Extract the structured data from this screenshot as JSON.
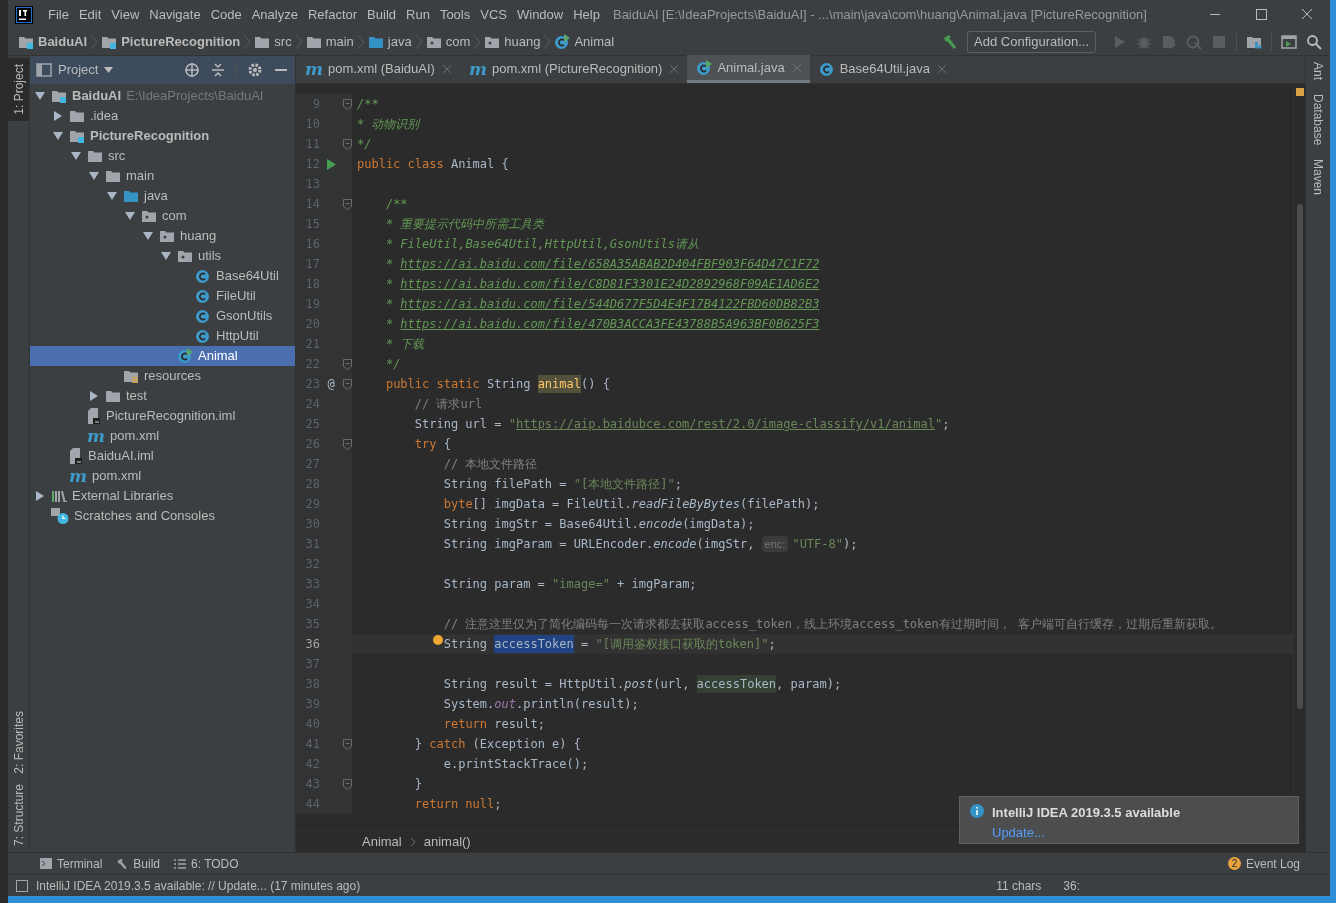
{
  "window": {
    "title": "BaiduAI [E:\\IdeaProjects\\BaiduAI] - ...\\main\\java\\com\\huang\\Animal.java [PictureRecognition]"
  },
  "menu": [
    "File",
    "Edit",
    "View",
    "Navigate",
    "Code",
    "Analyze",
    "Refactor",
    "Build",
    "Run",
    "Tools",
    "VCS",
    "Window",
    "Help"
  ],
  "breadcrumbs": [
    {
      "label": "BaiduAI",
      "kind": "module"
    },
    {
      "label": "PictureRecognition",
      "kind": "module"
    },
    {
      "label": "src",
      "kind": "folder"
    },
    {
      "label": "main",
      "kind": "folder"
    },
    {
      "label": "java",
      "kind": "source"
    },
    {
      "label": "com",
      "kind": "package"
    },
    {
      "label": "huang",
      "kind": "package"
    },
    {
      "label": "Animal",
      "kind": "runclass"
    }
  ],
  "toolbar": {
    "config_button": "Add Configuration..."
  },
  "left_strip": [
    "1: Project",
    "2: Favorites",
    "7: Structure"
  ],
  "right_strip": [
    "Ant",
    "Database",
    "Maven"
  ],
  "project": {
    "title": "Project",
    "tree": [
      {
        "label": "BaiduAI",
        "kind": "module",
        "hint": "E:\\IdeaProjects\\BaiduAI",
        "expanded": true,
        "selected": false,
        "children": [
          {
            "label": ".idea",
            "kind": "folder",
            "expanded": false,
            "selected": false
          },
          {
            "label": "PictureRecognition",
            "kind": "module",
            "expanded": true,
            "selected": false,
            "children": [
              {
                "label": "src",
                "kind": "folder",
                "expanded": true,
                "selected": false,
                "children": [
                  {
                    "label": "main",
                    "kind": "folder",
                    "expanded": true,
                    "selected": false,
                    "children": [
                      {
                        "label": "java",
                        "kind": "source",
                        "expanded": true,
                        "selected": false,
                        "children": [
                          {
                            "label": "com",
                            "kind": "package",
                            "expanded": true,
                            "selected": false,
                            "children": [
                              {
                                "label": "huang",
                                "kind": "package",
                                "expanded": true,
                                "selected": false,
                                "children": [
                                  {
                                    "label": "utils",
                                    "kind": "package",
                                    "expanded": true,
                                    "selected": false,
                                    "children": [
                                      {
                                        "label": "Base64Util",
                                        "kind": "class",
                                        "selected": false
                                      },
                                      {
                                        "label": "FileUtil",
                                        "kind": "class",
                                        "selected": false
                                      },
                                      {
                                        "label": "GsonUtils",
                                        "kind": "class",
                                        "selected": false
                                      },
                                      {
                                        "label": "HttpUtil",
                                        "kind": "class",
                                        "selected": false
                                      }
                                    ]
                                  },
                                  {
                                    "label": "Animal",
                                    "kind": "runclass",
                                    "selected": true
                                  }
                                ]
                              }
                            ]
                          }
                        ]
                      },
                      {
                        "label": "resources",
                        "kind": "resources",
                        "selected": false
                      }
                    ]
                  },
                  {
                    "label": "test",
                    "kind": "folder",
                    "expanded": false,
                    "selected": false
                  }
                ]
              },
              {
                "label": "PictureRecognition.iml",
                "kind": "iml",
                "selected": false
              },
              {
                "label": "pom.xml",
                "kind": "maven",
                "glyph": "m",
                "selected": false
              }
            ]
          },
          {
            "label": "BaiduAI.iml",
            "kind": "iml",
            "selected": false
          },
          {
            "label": "pom.xml",
            "kind": "maven",
            "glyph": "m",
            "selected": false
          }
        ]
      },
      {
        "label": "External Libraries",
        "kind": "libraries",
        "expanded": false,
        "selected": false
      },
      {
        "label": "Scratches and Consoles",
        "kind": "scratches",
        "selected": false
      }
    ]
  },
  "tabs": [
    {
      "label": "pom.xml (BaiduAI)",
      "kind": "maven",
      "glyph": "m",
      "selected": false
    },
    {
      "label": "pom.xml (PictureRecognition)",
      "kind": "maven",
      "glyph": "m",
      "selected": false
    },
    {
      "label": "Animal.java",
      "kind": "runclass",
      "selected": true
    },
    {
      "label": "Base64Util.java",
      "kind": "class",
      "selected": false
    }
  ],
  "code": [
    {
      "n": "9",
      "fold": true,
      "tokens": [
        {
          "kind": "doc",
          "text": "/**"
        }
      ]
    },
    {
      "n": "10",
      "tokens": [
        {
          "kind": "doc",
          "text": "* 动物识别"
        }
      ]
    },
    {
      "n": "11",
      "fold": true,
      "tokens": [
        {
          "kind": "doc",
          "text": "*/"
        }
      ]
    },
    {
      "n": "12",
      "gutter": {
        "kind": "run"
      },
      "tokens": [
        {
          "kind": "kw",
          "text": "public class "
        },
        {
          "kind": "plain",
          "text": "Animal {"
        }
      ]
    },
    {
      "n": "13"
    },
    {
      "n": "14",
      "fold": true,
      "tokens": [
        {
          "kind": "doc",
          "text": "    /**"
        }
      ]
    },
    {
      "n": "15",
      "tokens": [
        {
          "kind": "doc",
          "text": "    * 重要提示代码中所需工具类"
        }
      ]
    },
    {
      "n": "16",
      "tokens": [
        {
          "kind": "doc",
          "text": "    * FileUtil,Base64Util,HttpUtil,GsonUtils请从"
        }
      ]
    },
    {
      "n": "17",
      "tokens": [
        {
          "kind": "doc",
          "text": "    * "
        },
        {
          "kind": "doclink",
          "text": "https://ai.baidu.com/file/658A35ABAB2D404FBF903F64D47C1F72"
        }
      ]
    },
    {
      "n": "18",
      "tokens": [
        {
          "kind": "doc",
          "text": "    * "
        },
        {
          "kind": "doclink",
          "text": "https://ai.baidu.com/file/C8D81F3301E24D2892968F09AE1AD6E2"
        }
      ]
    },
    {
      "n": "19",
      "tokens": [
        {
          "kind": "doc",
          "text": "    * "
        },
        {
          "kind": "doclink",
          "text": "https://ai.baidu.com/file/544D677F5D4E4F17B4122FBD60DB82B3"
        }
      ]
    },
    {
      "n": "20",
      "tokens": [
        {
          "kind": "doc",
          "text": "    * "
        },
        {
          "kind": "doclink",
          "text": "https://ai.baidu.com/file/470B3ACCA3FE43788B5A963BF0B625F3"
        }
      ]
    },
    {
      "n": "21",
      "tokens": [
        {
          "kind": "doc",
          "text": "    * 下载"
        }
      ]
    },
    {
      "n": "22",
      "fold": true,
      "tokens": [
        {
          "kind": "doc",
          "text": "    */"
        }
      ]
    },
    {
      "n": "23",
      "gutter": {
        "kind": "override",
        "glyph": "@"
      },
      "fold": true,
      "tokens": [
        {
          "kind": "kw",
          "text": "    public static "
        },
        {
          "kind": "plain",
          "text": "String "
        },
        {
          "kind": "decl",
          "text": "animal"
        },
        {
          "kind": "plain",
          "text": "() {"
        }
      ]
    },
    {
      "n": "24",
      "tokens": [
        {
          "kind": "comment",
          "text": "        // 请求url"
        }
      ]
    },
    {
      "n": "25",
      "tokens": [
        {
          "kind": "plain",
          "text": "        String url = "
        },
        {
          "kind": "str",
          "text": "\""
        },
        {
          "kind": "strlink",
          "text": "https://aip.baidubce.com/rest/2.0/image-classify/v1/animal"
        },
        {
          "kind": "str",
          "text": "\""
        },
        {
          "kind": "plain",
          "text": ";"
        }
      ]
    },
    {
      "n": "26",
      "fold": true,
      "tokens": [
        {
          "kind": "kw",
          "text": "        try "
        },
        {
          "kind": "plain",
          "text": "{"
        }
      ]
    },
    {
      "n": "27",
      "tokens": [
        {
          "kind": "comment",
          "text": "            // 本地文件路径"
        }
      ]
    },
    {
      "n": "28",
      "tokens": [
        {
          "kind": "plain",
          "text": "            String filePath = "
        },
        {
          "kind": "str",
          "text": "\"[本地文件路径]\""
        },
        {
          "kind": "plain",
          "text": ";"
        }
      ]
    },
    {
      "n": "29",
      "tokens": [
        {
          "kind": "kw",
          "text": "            byte"
        },
        {
          "kind": "plain",
          "text": "[] imgData = FileUtil."
        },
        {
          "kind": "static",
          "text": "readFileByBytes"
        },
        {
          "kind": "plain",
          "text": "(filePath);"
        }
      ]
    },
    {
      "n": "30",
      "tokens": [
        {
          "kind": "plain",
          "text": "            String imgStr = Base64Util."
        },
        {
          "kind": "static",
          "text": "encode"
        },
        {
          "kind": "plain",
          "text": "(imgData);"
        }
      ]
    },
    {
      "n": "31",
      "tokens": [
        {
          "kind": "plain",
          "text": "            String imgParam = URLEncoder."
        },
        {
          "kind": "static",
          "text": "encode"
        },
        {
          "kind": "plain",
          "text": "(imgStr, "
        },
        {
          "kind": "hint",
          "text": "enc:"
        },
        {
          "kind": "str",
          "text": "\"UTF-8\""
        },
        {
          "kind": "plain",
          "text": ");"
        }
      ]
    },
    {
      "n": "32"
    },
    {
      "n": "33",
      "tokens": [
        {
          "kind": "plain",
          "text": "            String param = "
        },
        {
          "kind": "str",
          "text": "\"image=\""
        },
        {
          "kind": "plain",
          "text": " + imgParam;"
        }
      ]
    },
    {
      "n": "34"
    },
    {
      "n": "35",
      "tokens": [
        {
          "kind": "comment",
          "text": "            // 注意这里仅为了简化编码每一次请求都去获取access_token，线上环境access_token有过期时间， 客户端可自行缓存，过期后重新获取。"
        }
      ]
    },
    {
      "n": "36",
      "current": true,
      "tokens": [
        {
          "kind": "plain",
          "text": "            String "
        },
        {
          "kind": "sel",
          "text": "accessToken"
        },
        {
          "kind": "plain",
          "text": " = "
        },
        {
          "kind": "str",
          "text": "\"[调用鉴权接口获取的token]\""
        },
        {
          "kind": "plain",
          "text": ";"
        }
      ]
    },
    {
      "n": "37"
    },
    {
      "n": "38",
      "tokens": [
        {
          "kind": "plain",
          "text": "            String result = HttpUtil."
        },
        {
          "kind": "static",
          "text": "post"
        },
        {
          "kind": "plain",
          "text": "(url, "
        },
        {
          "kind": "usage",
          "text": "accessToken"
        },
        {
          "kind": "plain",
          "text": ", param);"
        }
      ]
    },
    {
      "n": "39",
      "tokens": [
        {
          "kind": "plain",
          "text": "            System."
        },
        {
          "kind": "field",
          "text": "out"
        },
        {
          "kind": "plain",
          "text": ".println(result);"
        }
      ]
    },
    {
      "n": "40",
      "tokens": [
        {
          "kind": "kw",
          "text": "            return "
        },
        {
          "kind": "plain",
          "text": "result;"
        }
      ]
    },
    {
      "n": "41",
      "fold": true,
      "tokens": [
        {
          "kind": "plain",
          "text": "        } "
        },
        {
          "kind": "kw",
          "text": "catch "
        },
        {
          "kind": "plain",
          "text": "(Exception e) {"
        }
      ]
    },
    {
      "n": "42",
      "tokens": [
        {
          "kind": "plain",
          "text": "            e.printStackTrace();"
        }
      ]
    },
    {
      "n": "43",
      "fold": true,
      "tokens": [
        {
          "kind": "plain",
          "text": "        }"
        }
      ]
    },
    {
      "n": "44",
      "tokens": [
        {
          "kind": "kw",
          "text": "        return null"
        },
        {
          "kind": "plain",
          "text": ";"
        }
      ]
    }
  ],
  "editor_breadcrumbs": [
    "Animal",
    "animal()"
  ],
  "notification": {
    "title": "IntelliJ IDEA 2019.3.5 available",
    "link": "Update..."
  },
  "tool_tabs": [
    {
      "label": "Terminal",
      "kind": "terminal"
    },
    {
      "label": "Build",
      "kind": "build"
    },
    {
      "label": "6: TODO",
      "kind": "todo"
    }
  ],
  "event_log": {
    "label": "Event Log",
    "count": "2"
  },
  "status_bar": {
    "message": "IntelliJ IDEA 2019.3.5 available: // Update... (17 minutes ago)",
    "chars": "11 chars",
    "position": "36:"
  }
}
